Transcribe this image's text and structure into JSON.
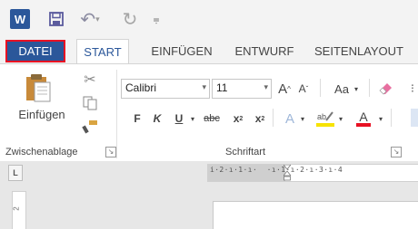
{
  "qat": {
    "app_icon_label": "W",
    "items": [
      "word-icon",
      "save-icon",
      "undo-icon",
      "redo-icon",
      "customize-icon"
    ]
  },
  "tabs": {
    "datei": "DATEI",
    "start": "START",
    "einfuegen": "EINFÜGEN",
    "entwurf": "ENTWURF",
    "seitenlayout": "SEITENLAYOUT"
  },
  "clipboard": {
    "paste_label": "Einfügen",
    "group_label": "Zwischenablage"
  },
  "font": {
    "font_name": "Calibri",
    "font_size": "11",
    "grow": "A",
    "shrink": "A",
    "change_case": "Aa",
    "bold": "F",
    "italic": "K",
    "underline": "U",
    "strikethrough": "abc",
    "subscript": "x",
    "superscript": "x",
    "text_effects": "A",
    "font_color": "A",
    "group_label": "Schriftart"
  },
  "ruler": {
    "tab_selector": "L",
    "ticks": "i·2·ı·1·ı·  ·ı·1·ı·2·ı·3·ı·4",
    "vertical_number": "2"
  },
  "colors": {
    "accent": "#2b579a",
    "highlight_outline": "#e81123",
    "font_color": "#e81123",
    "highlight": "#f7e300"
  }
}
